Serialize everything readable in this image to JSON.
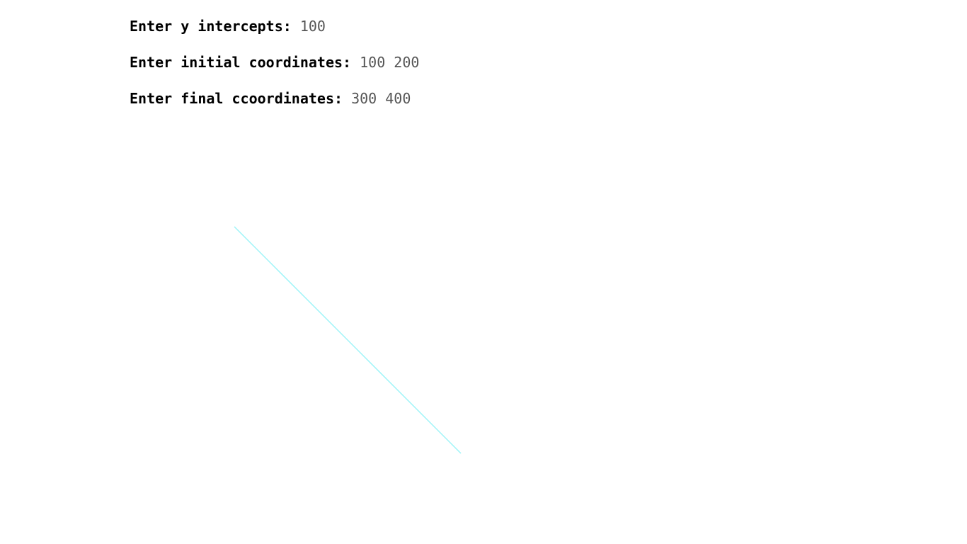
{
  "console": {
    "lines": [
      {
        "prompt": "Enter y intercepts: ",
        "input": "100"
      },
      {
        "prompt": "Enter initial coordinates: ",
        "input": "100 200"
      },
      {
        "prompt": "Enter final ccoordinates: ",
        "input": "300 400"
      }
    ]
  },
  "drawing": {
    "line_color": "#9ef4f8",
    "background_color": "#ffffff"
  }
}
